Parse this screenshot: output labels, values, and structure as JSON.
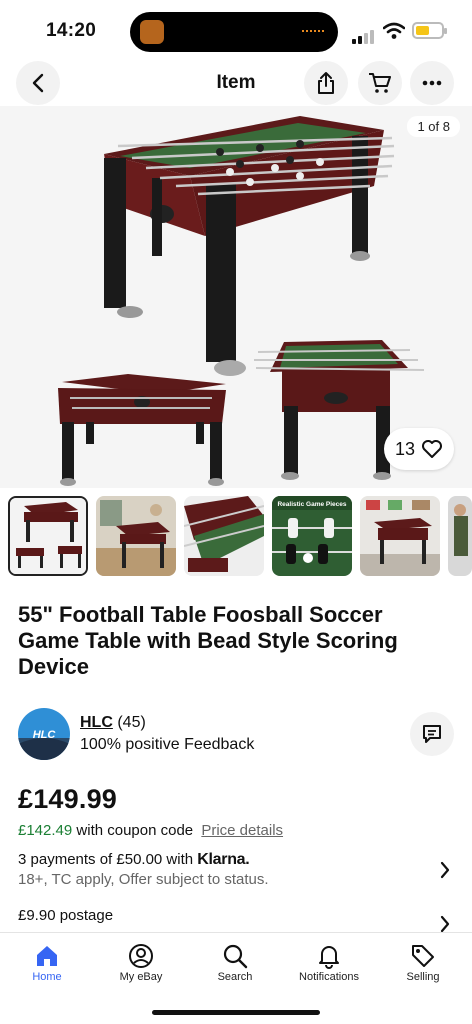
{
  "status": {
    "time": "14:20",
    "battery_level": 0.55,
    "battery_color": "#f5c518"
  },
  "header": {
    "title": "Item",
    "icons": [
      "back-icon",
      "share-icon",
      "cart-icon",
      "more-icon"
    ]
  },
  "gallery": {
    "counter": "1 of 8",
    "watch_count": "13"
  },
  "thumbnails": [
    {
      "label": ""
    },
    {
      "label": ""
    },
    {
      "label": ""
    },
    {
      "label": "Realistic Game Pieces"
    },
    {
      "label": ""
    }
  ],
  "product": {
    "title": "55\" Football Table Foosball Soccer Game Table with Bead Style Scoring Device"
  },
  "seller": {
    "name": "HLC",
    "count": "(45)",
    "feedback": "100% positive Feedback"
  },
  "pricing": {
    "price": "£149.99",
    "coupon_price": "£142.49",
    "coupon_text": "with coupon code",
    "details_link": "Price details",
    "klarna_text": "3 payments of £50.00 with",
    "klarna_brand": "Klarna.",
    "klarna_sub": "18+, TC apply, Offer subject to status.",
    "postage": "£9.90 postage"
  },
  "tabs": [
    {
      "label": "Home",
      "icon": "home-icon",
      "active": true
    },
    {
      "label": "My eBay",
      "icon": "user-icon",
      "active": false
    },
    {
      "label": "Search",
      "icon": "search-icon",
      "active": false
    },
    {
      "label": "Notifications",
      "icon": "bell-icon",
      "active": false
    },
    {
      "label": "Selling",
      "icon": "tag-icon",
      "active": false
    }
  ],
  "colors": {
    "accent": "#3665f3",
    "coupon_green": "#1b7f34"
  }
}
